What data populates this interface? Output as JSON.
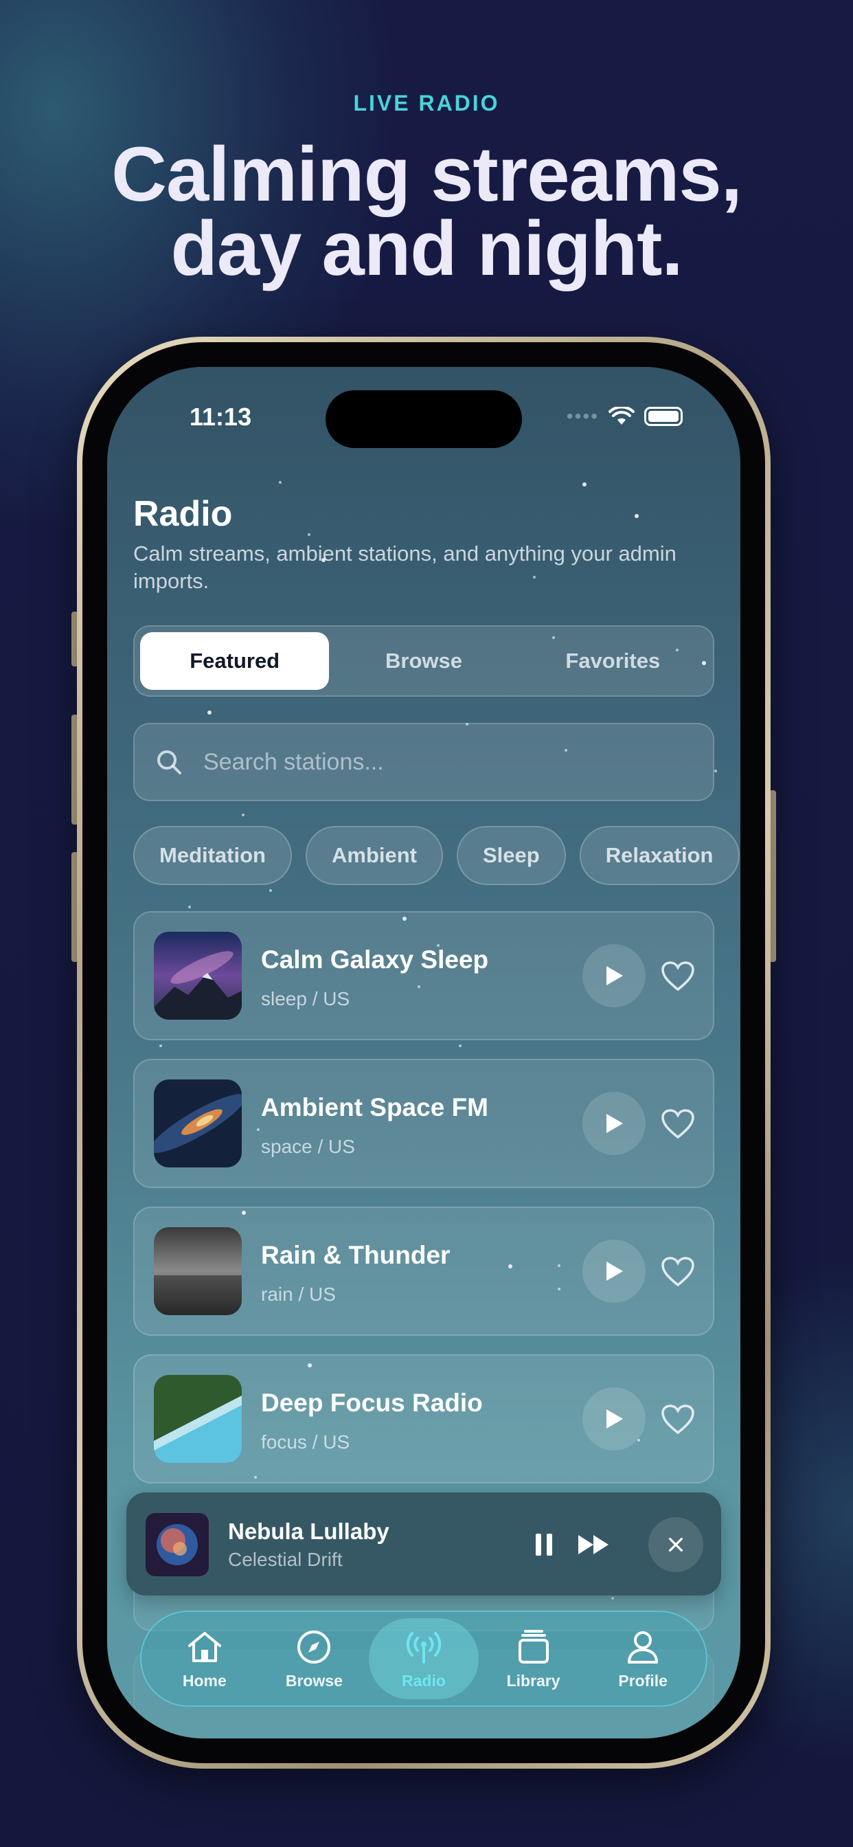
{
  "hero": {
    "eyebrow": "LIVE RADIO",
    "headline_line1": "Calming streams,",
    "headline_line2": "day and night."
  },
  "status_bar": {
    "time": "11:13"
  },
  "page": {
    "title": "Radio",
    "subtitle": "Calm streams, ambient stations, and anything your admin imports."
  },
  "segments": [
    {
      "label": "Featured",
      "active": true
    },
    {
      "label": "Browse",
      "active": false
    },
    {
      "label": "Favorites",
      "active": false
    }
  ],
  "search": {
    "placeholder": "Search stations..."
  },
  "chips": [
    "Meditation",
    "Ambient",
    "Sleep",
    "Relaxation"
  ],
  "stations": [
    {
      "name": "Calm Galaxy Sleep",
      "meta": "sleep / US",
      "thumb": "mountain-galaxy"
    },
    {
      "name": "Ambient Space FM",
      "meta": "space / US",
      "thumb": "milky-way"
    },
    {
      "name": "Rain & Thunder",
      "meta": "rain / US",
      "thumb": "rain"
    },
    {
      "name": "Deep Focus Radio",
      "meta": "focus / US",
      "thumb": "forest-shore"
    }
  ],
  "now_playing": {
    "title": "Nebula Lullaby",
    "artist": "Celestial Drift"
  },
  "tabs": [
    {
      "label": "Home",
      "icon": "home-icon",
      "active": false
    },
    {
      "label": "Browse",
      "icon": "compass-icon",
      "active": false
    },
    {
      "label": "Radio",
      "icon": "radio-icon",
      "active": true
    },
    {
      "label": "Library",
      "icon": "library-icon",
      "active": false
    },
    {
      "label": "Profile",
      "icon": "profile-icon",
      "active": false
    }
  ],
  "colors": {
    "accent": "#49d4d8",
    "background": "#161a40",
    "headline": "#eceaf8"
  }
}
